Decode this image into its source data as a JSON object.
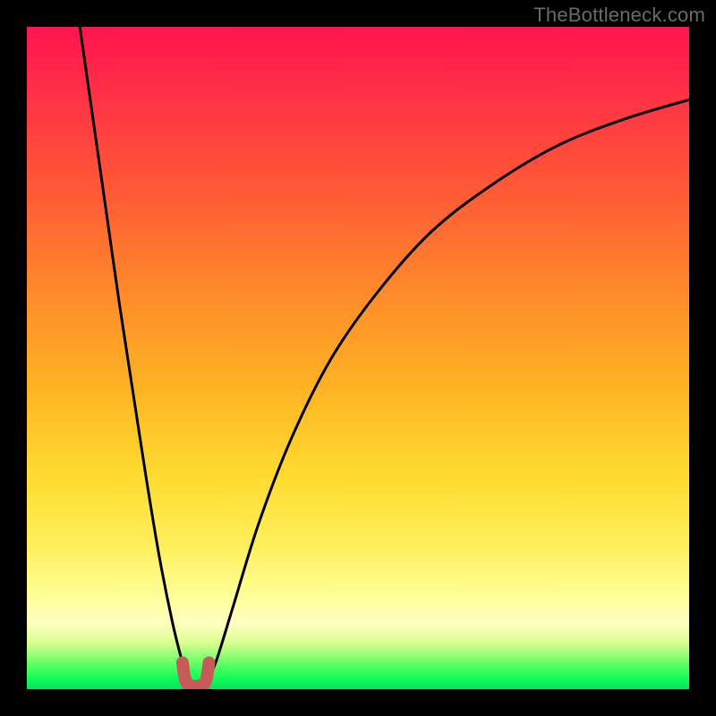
{
  "watermark": "TheBottleneck.com",
  "chart_data": {
    "type": "line",
    "title": "",
    "xlabel": "",
    "ylabel": "",
    "xlim": [
      0,
      100
    ],
    "ylim": [
      0,
      100
    ],
    "background_gradient": {
      "top": "#ff1450",
      "mid_upper": "#ff8a2a",
      "mid": "#ffdc30",
      "mid_lower": "#ffff99",
      "bottom": "#00e65a"
    },
    "series": [
      {
        "name": "left-branch",
        "color": "#000000",
        "x": [
          8,
          10,
          12,
          14,
          16,
          18,
          20,
          22,
          23.5,
          24.5
        ],
        "y": [
          100,
          86,
          72,
          58,
          45,
          32,
          20,
          10,
          4,
          1
        ]
      },
      {
        "name": "right-branch",
        "color": "#000000",
        "x": [
          27,
          28.5,
          31,
          35,
          40,
          46,
          53,
          61,
          70,
          80,
          90,
          100
        ],
        "y": [
          1,
          4,
          12,
          25,
          38,
          50,
          60,
          69,
          76,
          82,
          86,
          89
        ]
      },
      {
        "name": "valley-marker",
        "color": "#cc5a5a",
        "x": [
          23.5,
          24,
          25,
          26,
          27,
          27.5
        ],
        "y": [
          4,
          1.2,
          0.5,
          0.5,
          1.2,
          4
        ]
      }
    ],
    "annotations": []
  }
}
